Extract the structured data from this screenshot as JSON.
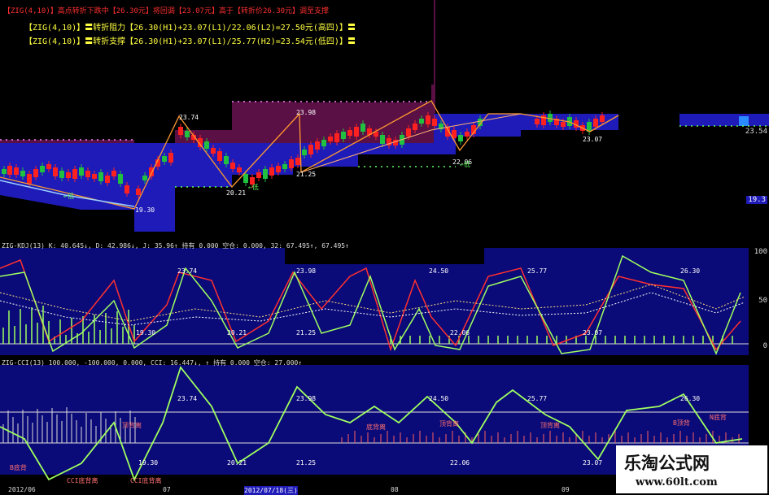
{
  "header": {
    "line0": "【ZIG(4,10)】高点转折下跌中【26.30元】将回调【23.07元】高于【转折价26.30元】调至支撑",
    "line1": "【ZIG(4,10)】〓转折阻力【26.30(H1)+23.07(L1)/22.06(L2)=27.50元(高四)】〓",
    "line2": "【ZIG(4,10)】〓转折支撑【26.30(H1)+23.07(L1)/25.77(H2)=23.54元(低四)】〓"
  },
  "kdj_info": "ZIG-KDJ(13)  K: 40.645↓, D: 42.986↓, J: 35.96↑ 持有 0.000 空仓: 0.000, 32: 67.495↑, 67.495↑",
  "cci_info": "ZIG-CCI(13) 100.000, -100.000, 0.000, CCI: 16.447↓, ↑ 持有 0.000 空仓: 27.000↑",
  "price_labels": [
    "23.74",
    "23.98",
    "24.50",
    "25.77",
    "26.30",
    "19.30",
    "20.21",
    "21.25",
    "22.06",
    "23.07",
    "23.54"
  ],
  "axis_labels": [
    "23.54",
    "19.3",
    "100",
    "50",
    "0"
  ],
  "small_labels": [
    "←低",
    "←低",
    "←低"
  ],
  "kdj_labels": [
    "23.74",
    "23.98",
    "24.50",
    "25.77",
    "26.30",
    "19.30",
    "20.21",
    "21.25",
    "22.06",
    "23.07"
  ],
  "cci_labels": [
    "23.74",
    "23.98",
    "24.50",
    "25.77",
    "26.30",
    "19.30",
    "20.21",
    "21.25",
    "22.06",
    "23.07"
  ],
  "cci_notes": [
    "顶背离",
    "B底背",
    "底背离",
    "顶背离",
    "顶背离",
    "B顶背",
    "N底背",
    "CCI底背离",
    "CCI底背离"
  ],
  "dates": [
    "2012/06",
    "07",
    "2012/07/18(三)",
    "08",
    "09"
  ],
  "watermark": {
    "title": "乐淘公式网",
    "url": "www.60lt.com"
  },
  "colors": {
    "purple": "#5a0f45",
    "blue": "#1f1bb8",
    "navy": "#0a0a78",
    "up": "#ff2020",
    "down": "#20c040",
    "zig": "#ff9a30",
    "kline": "#ff3030",
    "dline": "#9fff60"
  }
}
